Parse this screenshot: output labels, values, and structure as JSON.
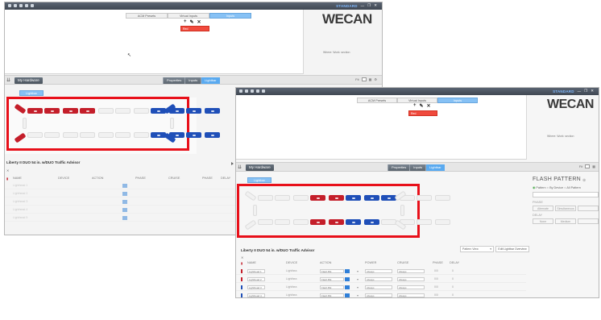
{
  "back_window": {
    "mode_label": "STANDARD",
    "center_tabs": [
      "ACM Presets",
      "Virtual Inputs",
      "Inputs"
    ],
    "active_tab": 2,
    "red_item": "Red",
    "logo": "WECAN",
    "where_text": "Where: Work: section",
    "hardware_button": "My Hardware",
    "panel_tabs": [
      "Properties",
      "Inputs",
      "Lightbar"
    ],
    "active_panel_tab": 2,
    "zoom_label": "Fit",
    "lightbar_tab": "Lightbar",
    "product_title": "Liberty II DUO 54 in. w/DUO Traffic Advisor",
    "columns": [
      "NAME",
      "DEVICE",
      "ACTION",
      "PHASE",
      "CRUISE",
      "PHASE",
      "DELAY"
    ],
    "rows": [
      "Lighthead 1",
      "Lighthead 2",
      "Lighthead 3",
      "Lighthead 4",
      "Lighthead 5"
    ]
  },
  "front_window": {
    "mode_label": "STANDARD",
    "center_tabs": [
      "ACM Presets",
      "Virtual Inputs",
      "Inputs"
    ],
    "active_tab": 2,
    "red_item": "Red",
    "logo": "WECAN",
    "where_text": "Where: Work: section",
    "hardware_button": "My Hardware",
    "panel_tabs": [
      "Properties",
      "Inputs",
      "Lightbar"
    ],
    "active_panel_tab": 2,
    "zoom_label": "Fit",
    "lightbar_tab": "Lightbar",
    "product_title": "Liberty II DUO 54 in. w/DUO Traffic Advisor",
    "pattern_select": "Pattern View",
    "edit_button": "Edit Lightbar Overview",
    "columns": [
      "NAME",
      "DEVICE",
      "ACTION",
      "POWER",
      "CRUISE",
      "PHASE",
      "DELAY"
    ],
    "rows": [
      {
        "name": "Lighthead 1",
        "device": "Lighthea",
        "action": "Flash Blk",
        "power": "Always",
        "cruise": "Always",
        "phase": "0/0",
        "delay": "0",
        "color": "#c41e2a"
      },
      {
        "name": "Lighthead 2",
        "device": "Lighthea",
        "action": "Flash Blk",
        "power": "Always",
        "cruise": "Always",
        "phase": "0/0",
        "delay": "0",
        "color": "#c41e2a"
      },
      {
        "name": "Lighthead 3",
        "device": "Lighthea",
        "action": "Flash Blk",
        "power": "Always",
        "cruise": "Always",
        "phase": "0/0",
        "delay": "0",
        "color": "#1f4fb8"
      },
      {
        "name": "Lighthead 4",
        "device": "Lighthea",
        "action": "Flash Blk",
        "power": "Always",
        "cruise": "Always",
        "phase": "0/0",
        "delay": "0",
        "color": "#1f4fb8"
      },
      {
        "name": "Lighthead 5",
        "device": "Lighthea",
        "action": "Flash Blk",
        "power": "Always",
        "cruise": "Always",
        "phase": "0/0",
        "delay": "0",
        "color": "#c41e2a"
      }
    ],
    "flash_pattern": {
      "title": "FLASH PATTERN",
      "options": [
        "Pattern",
        "By Device",
        "All Pattern"
      ],
      "phase_label": "PHASE",
      "phase_buttons": [
        "Alternate",
        "Simultaneous"
      ],
      "delay_label": "DELAY",
      "delay_buttons": [
        "None",
        "Medium"
      ]
    }
  },
  "colors": {
    "red": "#c41e2a",
    "blue": "#1f4fb8",
    "accent": "#86c1f5",
    "highlight": "#e8101a"
  }
}
